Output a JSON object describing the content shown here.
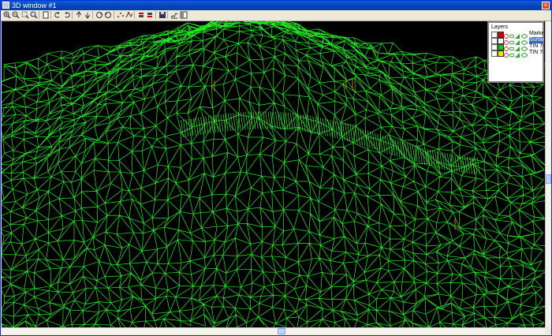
{
  "window": {
    "title": "3D window #1",
    "close_label": "×"
  },
  "toolbar": {
    "buttons": [
      {
        "name": "zoom-in-icon"
      },
      {
        "name": "zoom-out-icon"
      },
      {
        "name": "zoom-window-icon"
      },
      {
        "name": "zoom-extents-icon"
      },
      {
        "name": "page-icon"
      },
      {
        "name": "rotate-left-icon"
      },
      {
        "name": "rotate-right-icon"
      },
      {
        "name": "tilt-up-icon"
      },
      {
        "name": "tilt-down-icon"
      },
      {
        "name": "spin-cw-icon"
      },
      {
        "name": "spin-ccw-icon"
      },
      {
        "name": "points-icon"
      },
      {
        "name": "network-icon"
      },
      {
        "name": "flag-up-icon"
      },
      {
        "name": "flag-down-icon"
      },
      {
        "name": "save-icon"
      },
      {
        "name": "profile-icon"
      },
      {
        "name": "panel-icon"
      }
    ]
  },
  "layers": {
    "header": "Layers",
    "items": [
      {
        "label": "Marke",
        "color": "#cc0000",
        "selected": false
      },
      {
        "label": "Surfac",
        "color": "#ffffff",
        "selected": true
      },
      {
        "label": "TIN 7(",
        "color": "#00cc00",
        "selected": false
      },
      {
        "label": "TIN 7(",
        "color": "#e8e800",
        "selected": false
      }
    ]
  },
  "colors": {
    "mesh": "#22ee22",
    "background": "#000000",
    "accent": "#0a5fd8"
  }
}
